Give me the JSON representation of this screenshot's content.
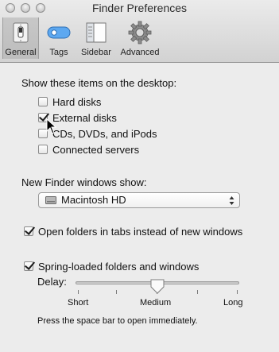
{
  "window": {
    "title": "Finder Preferences"
  },
  "toolbar": {
    "items": [
      {
        "label": "General",
        "icon": "switch-icon",
        "selected": true
      },
      {
        "label": "Tags",
        "icon": "tag-icon",
        "selected": false
      },
      {
        "label": "Sidebar",
        "icon": "sidebar-icon",
        "selected": false
      },
      {
        "label": "Advanced",
        "icon": "gear-icon",
        "selected": false
      }
    ]
  },
  "desktop": {
    "heading": "Show these items on the desktop:",
    "items": [
      {
        "label": "Hard disks",
        "checked": false
      },
      {
        "label": "External disks",
        "checked": true
      },
      {
        "label": "CDs, DVDs, and iPods",
        "checked": false
      },
      {
        "label": "Connected servers",
        "checked": false
      }
    ]
  },
  "new_window": {
    "heading": "New Finder windows show:",
    "selected": "Macintosh HD"
  },
  "tabs_option": {
    "label": "Open folders in tabs instead of new windows",
    "checked": true
  },
  "spring": {
    "label": "Spring-loaded folders and windows",
    "checked": true,
    "delay_label": "Delay:",
    "ticks": [
      "Short",
      "Medium",
      "Long"
    ],
    "level": "Medium",
    "hint": "Press the space bar to open immediately."
  }
}
